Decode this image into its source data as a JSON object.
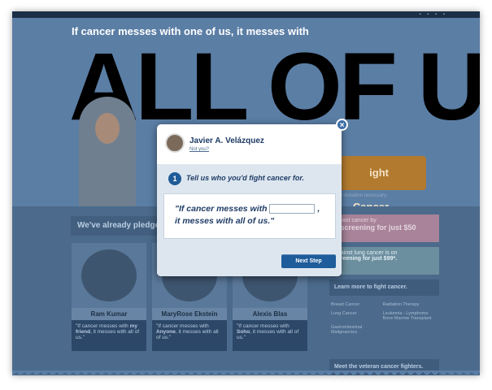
{
  "page": {
    "headline": "If cancer messes with one of us, it messes with",
    "big_word": "ALL OF US.",
    "top_right": "▪ ▪ ▪ ▪",
    "fight_button": "ight Cancer",
    "donation_note": "etary donation necessary.",
    "pledged_heading": "We've already pledged",
    "cards": [
      {
        "name": "Ram Kumar",
        "quote_pre": "\"If cancer messes with ",
        "quote_bold": "my friend",
        "quote_post": ", it messes with all of us.\""
      },
      {
        "name": "MaryRose Ekstein",
        "quote_pre": "\"If cancer messes with ",
        "quote_bold": "Anyone",
        "quote_post": ", it messes with all of us.\""
      },
      {
        "name": "Alexis Blas",
        "quote_pre": "\"If cancer messes with ",
        "quote_bold": "Soho",
        "quote_post": ", it messes with all of us.\""
      }
    ],
    "promo_pink_line1": "breast cancer by",
    "promo_pink_line2": "a screening for just $50",
    "promo_teal_line1": "against lung cancer is on",
    "promo_teal_line2": "screening for just $99*.",
    "learn_more": "Learn more to fight cancer.",
    "learn_links": [
      "Breast Cancer",
      "Radiation Therapy",
      "Lung Cancer",
      "Leukemia - Lymphoma Bone Marrow Transplant",
      "Gastrointestinal Malignancies"
    ],
    "meet_veterans": "Meet the veteran cancer fighters."
  },
  "modal": {
    "close_glyph": "×",
    "user_name": "Javier A. Velázquez",
    "not_you": "Not you?",
    "step_number": "1",
    "step_label": "Tell us who you'd fight cancer for.",
    "quote_part1": "\"If cancer messes with",
    "quote_comma": ",",
    "quote_part2": "it messes with all of us.\"",
    "input_value": "",
    "next_button": "Next Step"
  }
}
